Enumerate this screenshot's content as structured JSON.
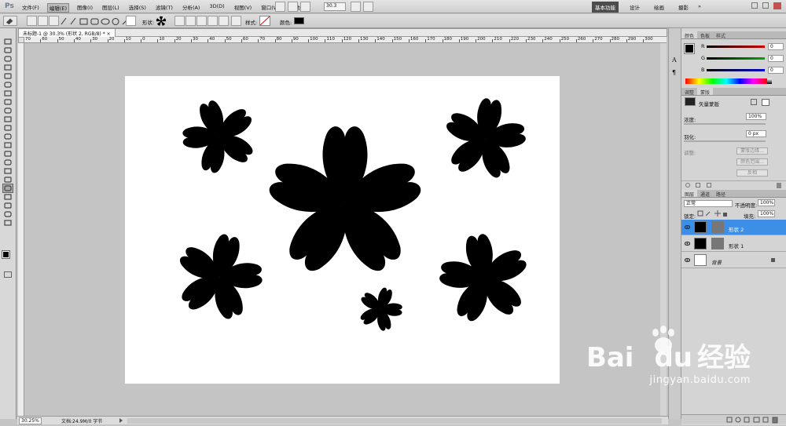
{
  "app": {
    "logo": "Ps"
  },
  "menu": [
    "文件(F)",
    "编辑(E)",
    "图像(I)",
    "图层(L)",
    "选择(S)",
    "滤镜(T)",
    "分析(A)",
    "3D(D)",
    "视图(V)",
    "窗口(W)",
    "帮助(H)"
  ],
  "menu_active_index": 1,
  "zoom": "30.3",
  "workspaces": [
    "基本功能",
    "设计",
    "绘画",
    "摄影"
  ],
  "workspace_more": "»",
  "options": {
    "shape_label": "形状:",
    "style_label": "样式:",
    "color_label": "颜色:",
    "color": "#000000"
  },
  "document": {
    "tab": "未标题-1 @ 30.3% (形状 2, RGB/8) *",
    "close": "×"
  },
  "ruler_h": [
    "70",
    "60",
    "50",
    "40",
    "30",
    "20",
    "10",
    "0",
    "10",
    "20",
    "30",
    "40",
    "50",
    "60",
    "70",
    "80",
    "90",
    "100",
    "110",
    "120",
    "130",
    "140",
    "150",
    "160",
    "170",
    "180",
    "190",
    "200",
    "210",
    "220",
    "230",
    "240",
    "250",
    "260",
    "270",
    "280",
    "290",
    "300"
  ],
  "status": {
    "zoom": "30.25%",
    "doc": "文档:24.9M/0 字节"
  },
  "color_panel": {
    "tabs": [
      "颜色",
      "色板",
      "样式"
    ],
    "channels": [
      {
        "label": "R",
        "value": "0"
      },
      {
        "label": "G",
        "value": "0"
      },
      {
        "label": "B",
        "value": "0"
      }
    ]
  },
  "masks_panel": {
    "tabs": [
      "调整",
      "蒙版"
    ],
    "vector_mask_label": "矢量蒙版",
    "density_label": "浓度:",
    "density_value": "100%",
    "feather_label": "羽化:",
    "feather_value": "0 px",
    "refine_label": "调整:",
    "buttons": [
      "蒙版边缘...",
      "颜色范围...",
      "反相"
    ]
  },
  "layers_panel": {
    "tabs": [
      "图层",
      "通道",
      "路径"
    ],
    "blend_mode": "正常",
    "opacity_label": "不透明度:",
    "opacity_value": "100%",
    "lock_label": "锁定:",
    "fill_label": "填充:",
    "fill_value": "100%",
    "layers": [
      {
        "name": "形状 2",
        "selected": true
      },
      {
        "name": "形状 1",
        "selected": false
      },
      {
        "name": "背景",
        "selected": false
      }
    ]
  },
  "watermark": {
    "bai": "Bai",
    "du": "du",
    "jingyan": "经验",
    "url": "jingyan.baidu.com"
  },
  "colors": {
    "selection": "#3d8ee6",
    "shape": "#000000",
    "canvas": "#ffffff"
  }
}
